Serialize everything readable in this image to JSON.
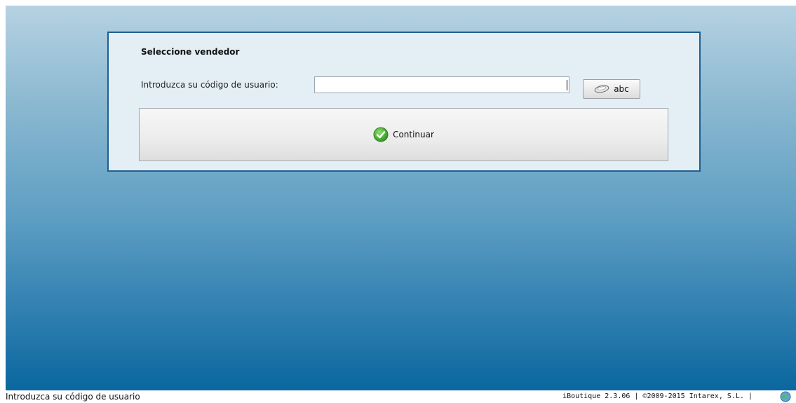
{
  "dialog": {
    "title": "Seleccione vendedor",
    "code_label": "Introduzca su código de usuario:",
    "code_input_value": "",
    "keyboard_button_label": "abc",
    "keyboard_icon": "keyboard-icon",
    "continue_label": "Continuar",
    "continue_icon": "check-icon"
  },
  "status_bar": {
    "message": "Introduzca su código de usuario",
    "version_text": "iBoutique 2.3.06 | ©2009-2015 Intarex, S.L. |",
    "globe_icon": "globe-icon"
  },
  "colors": {
    "dialog_border": "#1f5f91",
    "dialog_background": "#e3eef5",
    "background_top": "#b6d2e2",
    "background_bottom": "#0a679f",
    "check_green": "#43a52c"
  }
}
